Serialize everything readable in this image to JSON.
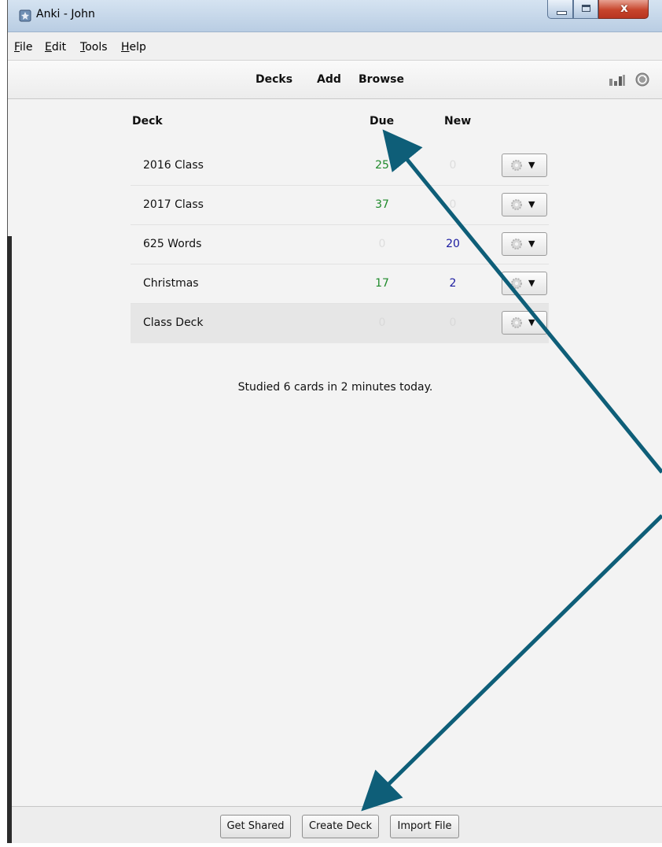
{
  "window": {
    "title": "Anki - John",
    "controls": {
      "close_glyph": "x"
    }
  },
  "menu": [
    {
      "pre": "",
      "u": "F",
      "post": "ile"
    },
    {
      "pre": "",
      "u": "E",
      "post": "dit"
    },
    {
      "pre": "",
      "u": "T",
      "post": "ools"
    },
    {
      "pre": "",
      "u": "H",
      "post": "elp"
    }
  ],
  "toolbar": {
    "links": [
      "Decks",
      "Add",
      "Browse"
    ],
    "icons": [
      "stats-icon",
      "sync-icon"
    ]
  },
  "deck_table": {
    "headers": {
      "deck": "Deck",
      "due": "Due",
      "new": "New"
    },
    "rows": [
      {
        "name": "2016 Class",
        "due": "25",
        "new": "0"
      },
      {
        "name": "2017 Class",
        "due": "37",
        "new": "0"
      },
      {
        "name": "625 Words",
        "due": "0",
        "new": "20"
      },
      {
        "name": "Christmas",
        "due": "17",
        "new": "2"
      },
      {
        "name": "Class Deck",
        "due": "0",
        "new": "0"
      }
    ],
    "colors": {
      "due": "#1f8a2b",
      "new": "#1a1aa0",
      "zero": "#dddddd"
    }
  },
  "studied_text": "Studied 6 cards in 2 minutes today.",
  "bottom_buttons": [
    "Get Shared",
    "Create Deck",
    "Import File"
  ],
  "annotation_color": "#0e5e78"
}
